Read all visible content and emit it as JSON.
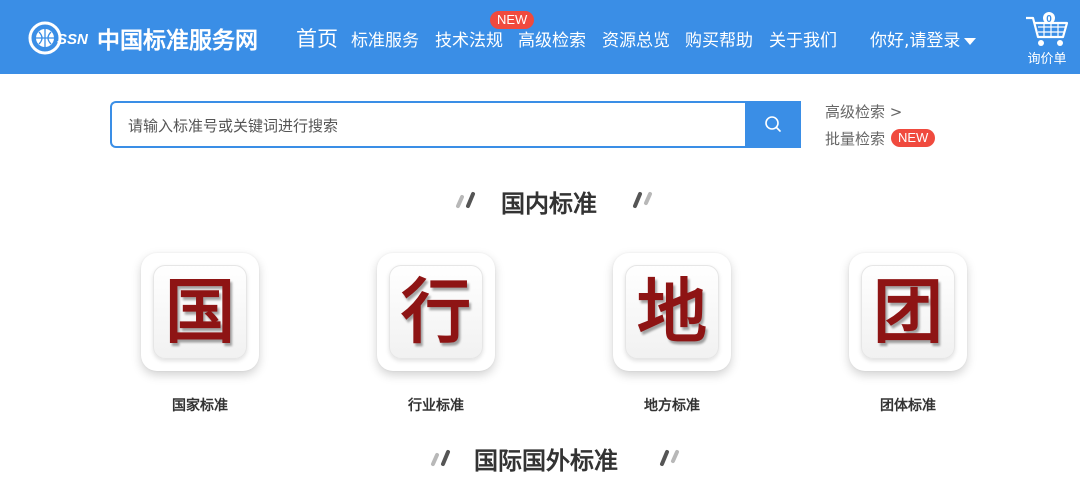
{
  "header": {
    "logo_mark": "SSN",
    "site_name": "中国标准服务网",
    "nav": [
      {
        "label": "首页"
      },
      {
        "label": "标准服务"
      },
      {
        "label": "技术法规",
        "badge": "NEW"
      },
      {
        "label": "高级检索"
      },
      {
        "label": "资源总览"
      },
      {
        "label": "购买帮助"
      },
      {
        "label": "关于我们"
      }
    ],
    "login": "你好,请登录",
    "cart_label": "询价单",
    "cart_count": "0",
    "color": "#3a8ee6"
  },
  "search": {
    "placeholder": "请输入标准号或关键词进行搜索",
    "advanced": "高级检索 >",
    "batch": "批量检索",
    "batch_badge": "NEW"
  },
  "domestic": {
    "title": "国内标准",
    "categories": [
      {
        "char": "国",
        "label": "国家标准"
      },
      {
        "char": "行",
        "label": "行业标准"
      },
      {
        "char": "地",
        "label": "地方标准"
      },
      {
        "char": "团",
        "label": "团体标准"
      }
    ]
  },
  "international": {
    "title": "国际国外标准"
  },
  "colors": {
    "accent": "#3a8ee6",
    "badge": "#f04a3e",
    "tile_char": "#8e1414"
  }
}
